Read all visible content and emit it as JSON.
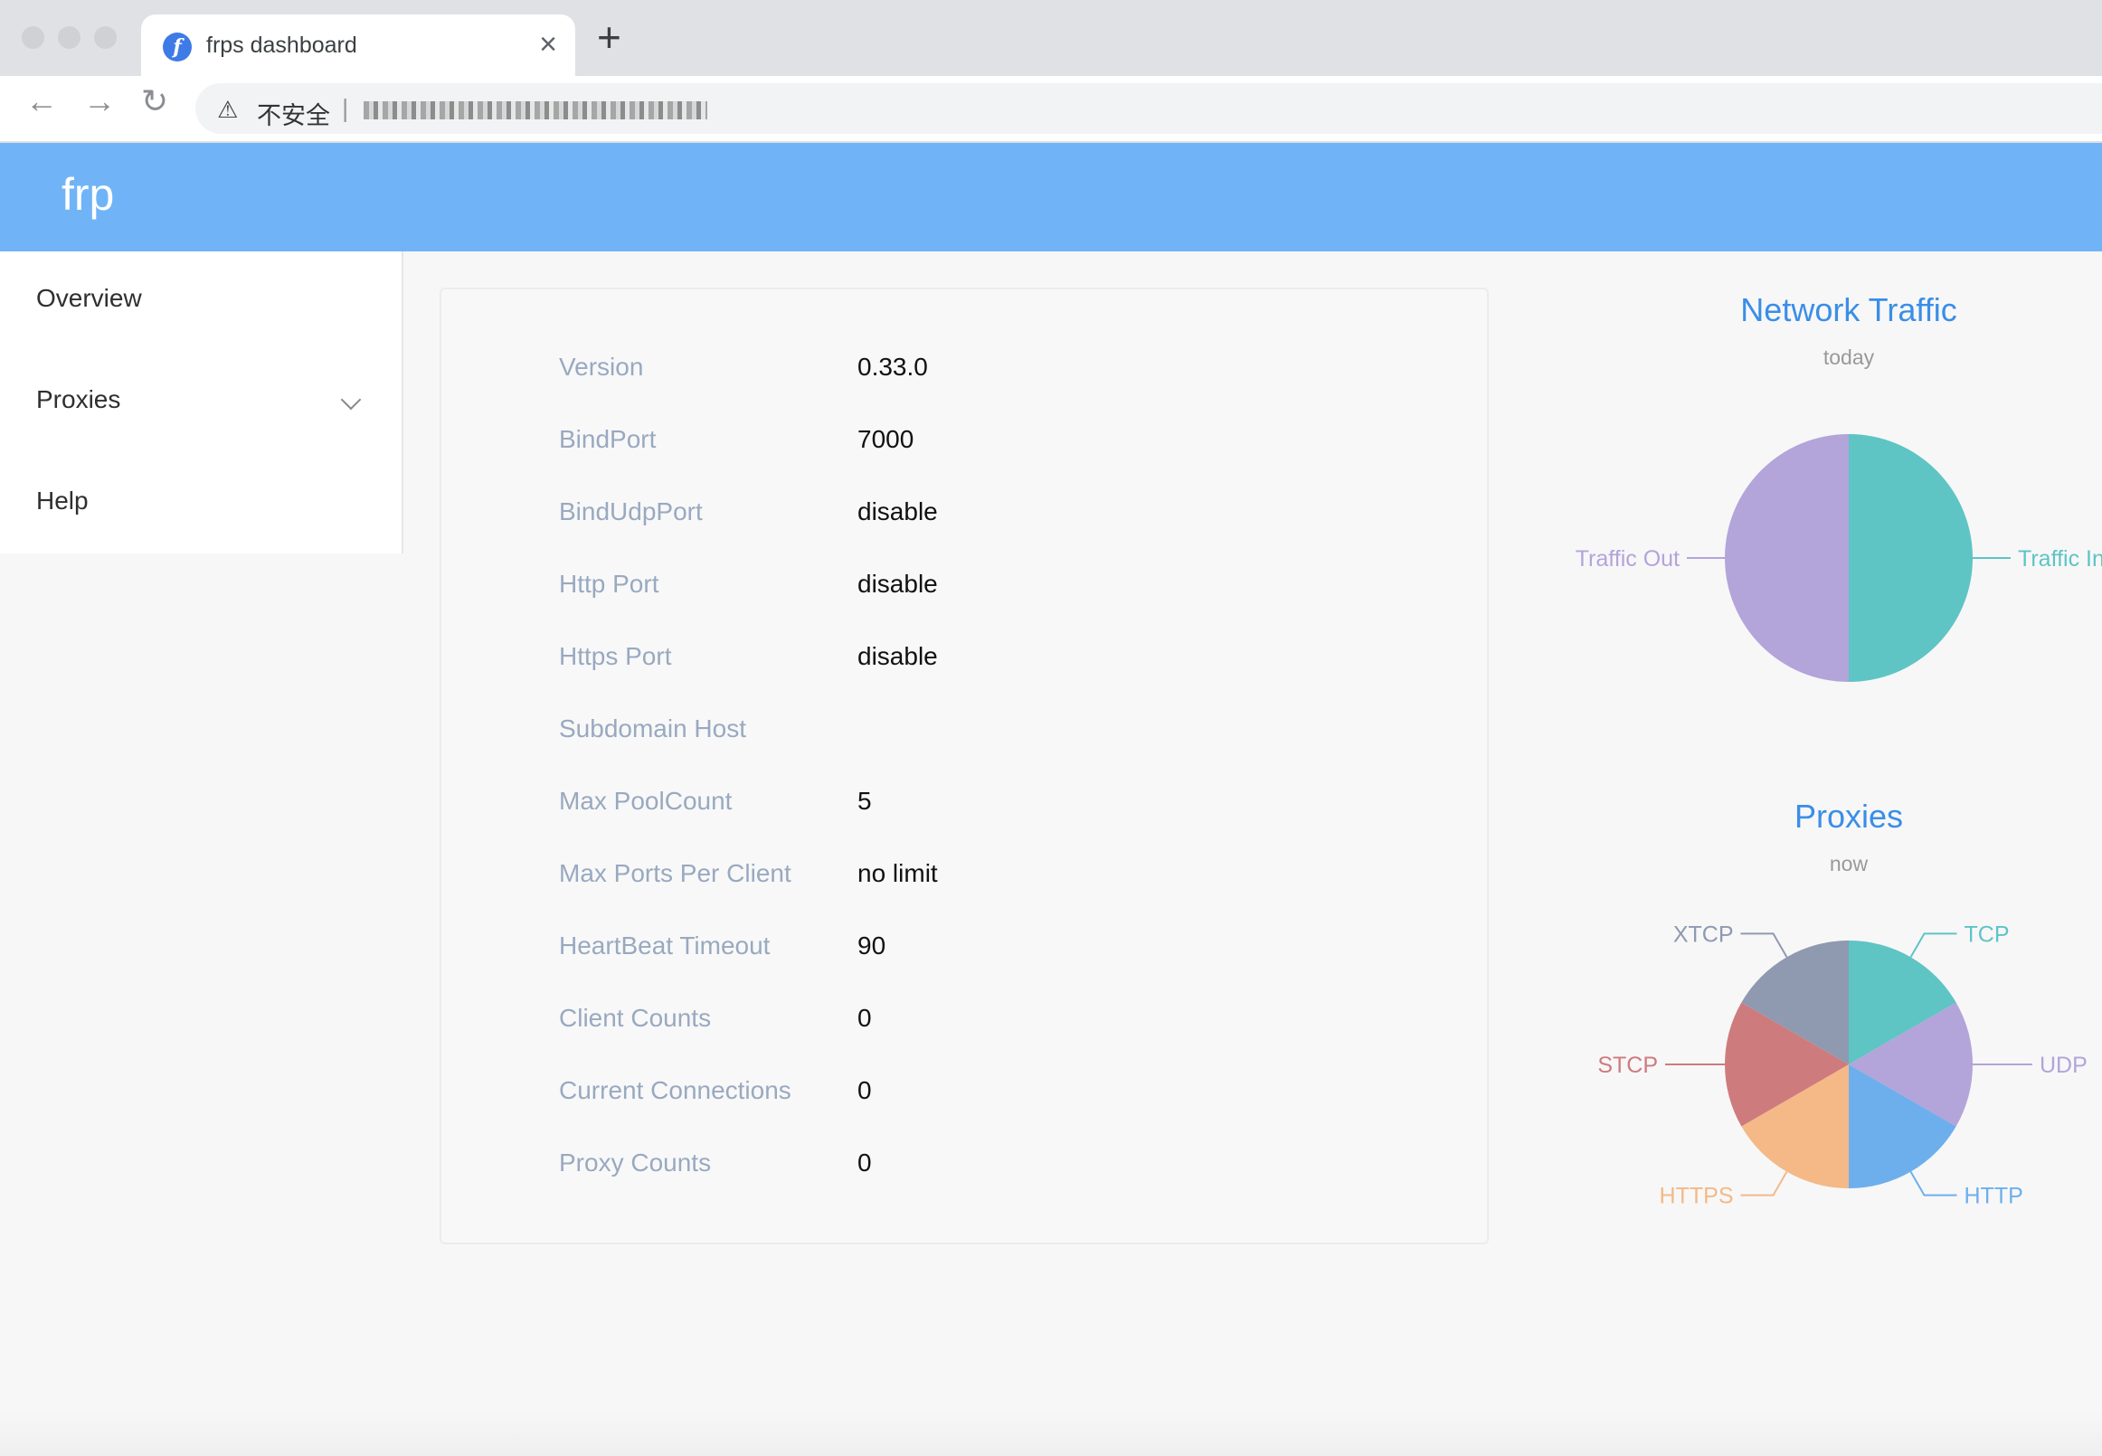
{
  "browser": {
    "tab_title": "frps dashboard",
    "favicon_letter": "f",
    "close_glyph": "×",
    "new_tab_glyph": "+",
    "back_glyph": "←",
    "forward_glyph": "→",
    "reload_glyph": "↻",
    "security_icon": "⚠",
    "security_label": "不安全",
    "url_separator": "|"
  },
  "app": {
    "brand": "frp"
  },
  "sidebar": {
    "items": [
      {
        "label": "Overview"
      },
      {
        "label": "Proxies"
      },
      {
        "label": "Help"
      }
    ]
  },
  "server_info": {
    "rows": [
      {
        "label": "Version",
        "value": "0.33.0"
      },
      {
        "label": "BindPort",
        "value": "7000"
      },
      {
        "label": "BindUdpPort",
        "value": "disable"
      },
      {
        "label": "Http Port",
        "value": "disable"
      },
      {
        "label": "Https Port",
        "value": "disable"
      },
      {
        "label": "Subdomain Host",
        "value": ""
      },
      {
        "label": "Max PoolCount",
        "value": "5"
      },
      {
        "label": "Max Ports Per Client",
        "value": "no limit"
      },
      {
        "label": "HeartBeat Timeout",
        "value": "90"
      },
      {
        "label": "Client Counts",
        "value": "0"
      },
      {
        "label": "Current Connections",
        "value": "0"
      },
      {
        "label": "Proxy Counts",
        "value": "0"
      }
    ]
  },
  "colors": {
    "header": "#70b4f7",
    "chart_title": "#3a8ee6"
  },
  "chart_data": [
    {
      "type": "pie",
      "title": "Network Traffic",
      "subtitle": "today",
      "categories": [
        "Traffic In",
        "Traffic Out"
      ],
      "values": [
        50,
        50
      ],
      "colors": [
        "#5fc4c4",
        "#b3a4da"
      ]
    },
    {
      "type": "pie",
      "title": "Proxies",
      "subtitle": "now",
      "categories": [
        "TCP",
        "UDP",
        "HTTP",
        "HTTPS",
        "STCP",
        "XTCP"
      ],
      "values": [
        1,
        1,
        1,
        1,
        1,
        1
      ],
      "colors": [
        "#5fc4c4",
        "#b3a4da",
        "#6dafec",
        "#f4b986",
        "#ce7b7e",
        "#8f99b0"
      ]
    }
  ]
}
